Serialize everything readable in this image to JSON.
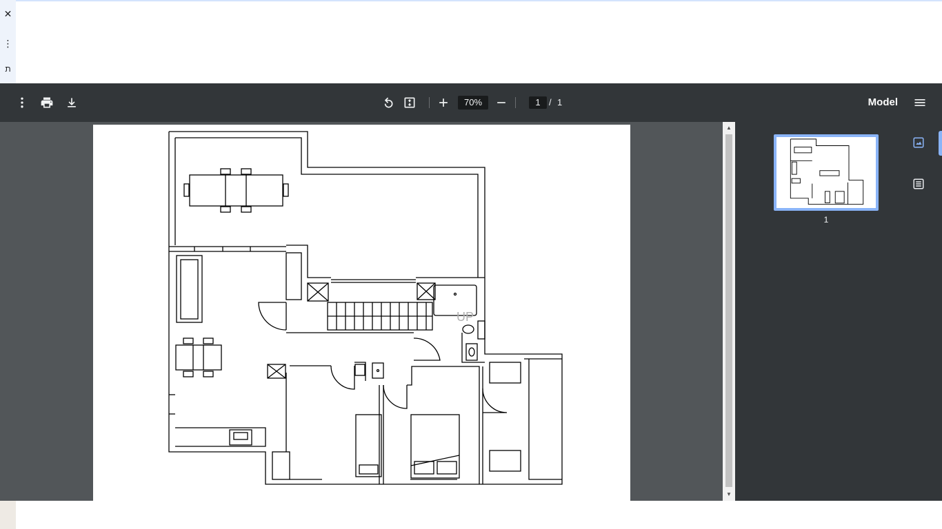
{
  "toolbar": {
    "zoom_value": "70%",
    "current_page": "1",
    "page_separator": "/",
    "total_pages": "1",
    "document_title": "Model",
    "icons": [
      "more-vert-icon",
      "print-icon",
      "download-icon",
      "rotate-icon",
      "fit-page-icon",
      "zoom-in-icon",
      "zoom-out-icon",
      "menu-icon"
    ]
  },
  "browser_side": {
    "close_glyph": "✕",
    "more_glyph": "⋮",
    "char_glyph": "ת"
  },
  "sidebar": {
    "thumbnail_label": "1",
    "tabs": [
      "thumbnails-tab-icon",
      "outline-tab-icon"
    ]
  },
  "floorplan": {
    "stair_label": "UP"
  },
  "colors": {
    "toolbar_bg": "#323639",
    "viewer_bg": "#525659",
    "accent": "#8ab4f8"
  }
}
